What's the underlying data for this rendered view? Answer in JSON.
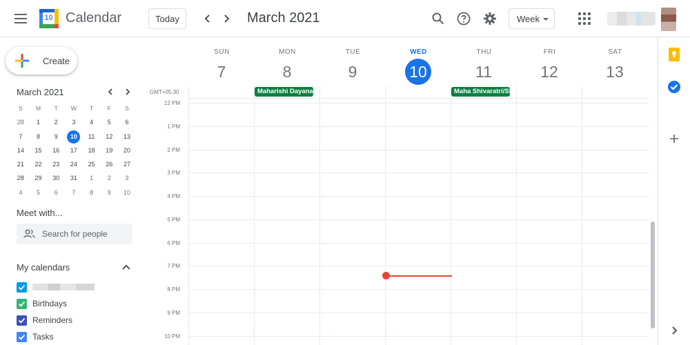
{
  "header": {
    "app_title": "Calendar",
    "logo_number": "10",
    "today_label": "Today",
    "period_title": "March 2021",
    "view_label": "Week"
  },
  "sidebar": {
    "create_label": "Create",
    "mini_calendar": {
      "title": "March 2021",
      "weekdays": [
        "S",
        "M",
        "T",
        "W",
        "T",
        "F",
        "S"
      ],
      "weeks": [
        [
          "28",
          "1",
          "2",
          "3",
          "4",
          "5",
          "6"
        ],
        [
          "7",
          "8",
          "9",
          "10",
          "11",
          "12",
          "13"
        ],
        [
          "14",
          "15",
          "16",
          "17",
          "18",
          "19",
          "20"
        ],
        [
          "21",
          "22",
          "23",
          "24",
          "25",
          "26",
          "27"
        ],
        [
          "28",
          "29",
          "30",
          "31",
          "1",
          "2",
          "3"
        ],
        [
          "4",
          "5",
          "6",
          "7",
          "8",
          "9",
          "10"
        ]
      ]
    },
    "meet_title": "Meet with...",
    "people_placeholder": "Search for people",
    "my_calendars_title": "My calendars",
    "calendars": [
      {
        "name": "",
        "color": "#039be5"
      },
      {
        "name": "Birthdays",
        "color": "#33b679"
      },
      {
        "name": "Reminders",
        "color": "#3f51b5"
      },
      {
        "name": "Tasks",
        "color": "#4285f4"
      }
    ]
  },
  "week": {
    "timezone": "GMT+05:30",
    "days": [
      {
        "dow": "SUN",
        "date": "7"
      },
      {
        "dow": "MON",
        "date": "8"
      },
      {
        "dow": "TUE",
        "date": "9"
      },
      {
        "dow": "WED",
        "date": "10"
      },
      {
        "dow": "THU",
        "date": "11"
      },
      {
        "dow": "FRI",
        "date": "12"
      },
      {
        "dow": "SAT",
        "date": "13"
      }
    ],
    "allday_events": [
      {
        "title": "Maharishi Dayanand",
        "color": "#0b8043"
      },
      {
        "title": "Maha Shivaratri/Shivaratri",
        "color": "#0b8043"
      }
    ],
    "hours": [
      "12 PM",
      "1 PM",
      "2 PM",
      "3 PM",
      "4 PM",
      "5 PM",
      "6 PM",
      "7 PM",
      "8 PM",
      "9 PM",
      "10 PM"
    ]
  },
  "colors": {
    "accent": "#1a73e8",
    "now_line": "#ea4335",
    "holiday": "#0b8043"
  },
  "icons": {
    "menu": "hamburger-icon",
    "search": "search-icon",
    "help": "help-icon",
    "settings": "gear-icon",
    "apps": "apps-grid-icon",
    "keep": "keep-icon",
    "tasks": "tasks-icon",
    "add": "plus-icon"
  }
}
